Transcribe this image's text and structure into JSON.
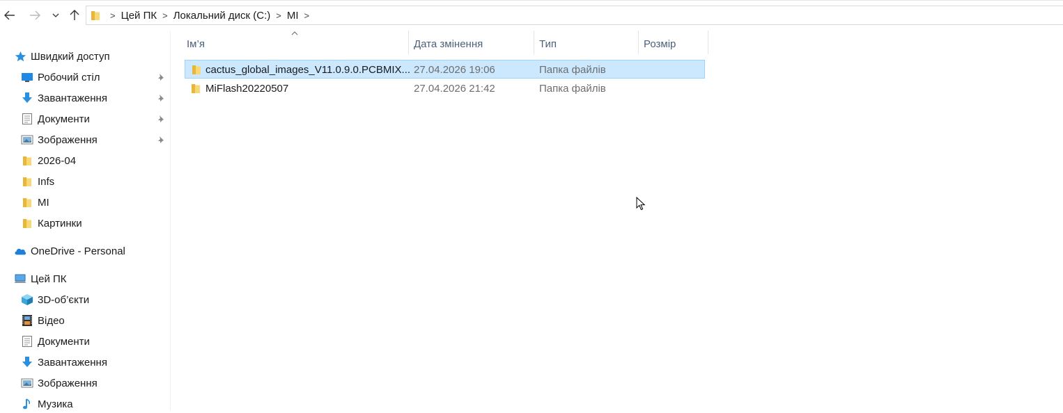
{
  "address": {
    "crumbs": [
      "Цей ПК",
      "Локальний диск (C:)",
      "MI"
    ]
  },
  "sidebar": {
    "quick_access": "Швидкий доступ",
    "quick_items": [
      {
        "label": "Робочий стіл",
        "icon": "desktop-icon",
        "pinned": true
      },
      {
        "label": "Завантаження",
        "icon": "download-icon",
        "pinned": true
      },
      {
        "label": "Документи",
        "icon": "documents-icon",
        "pinned": true
      },
      {
        "label": "Зображення",
        "icon": "pictures-icon",
        "pinned": true
      },
      {
        "label": "2026-04",
        "icon": "folder-icon",
        "pinned": false
      },
      {
        "label": "Infs",
        "icon": "folder-icon",
        "pinned": false
      },
      {
        "label": "MI",
        "icon": "folder-icon",
        "pinned": false
      },
      {
        "label": "Картинки",
        "icon": "folder-icon",
        "pinned": false
      }
    ],
    "onedrive": "OneDrive - Personal",
    "this_pc": "Цей ПК",
    "pc_items": [
      {
        "label": "3D-об’єкти",
        "icon": "3d-objects-icon"
      },
      {
        "label": "Відео",
        "icon": "video-icon"
      },
      {
        "label": "Документи",
        "icon": "documents-icon"
      },
      {
        "label": "Завантаження",
        "icon": "download-icon"
      },
      {
        "label": "Зображення",
        "icon": "pictures-icon"
      },
      {
        "label": "Музика",
        "icon": "music-icon"
      }
    ]
  },
  "columns": {
    "name": "Ім’я",
    "date": "Дата змінення",
    "type": "Тип",
    "size": "Розмір"
  },
  "files": [
    {
      "name": "cactus_global_images_V11.0.9.0.PCBMIX...",
      "date": "27.04.2026 19:06",
      "type": "Папка файлів",
      "size": "",
      "selected": true
    },
    {
      "name": "MiFlash20220507",
      "date": "27.04.2026 21:42",
      "type": "Папка файлів",
      "size": "",
      "selected": false
    }
  ],
  "colors": {
    "selection": "#cce8ff",
    "folder": "#f8d775",
    "accent": "#1e90ff"
  }
}
